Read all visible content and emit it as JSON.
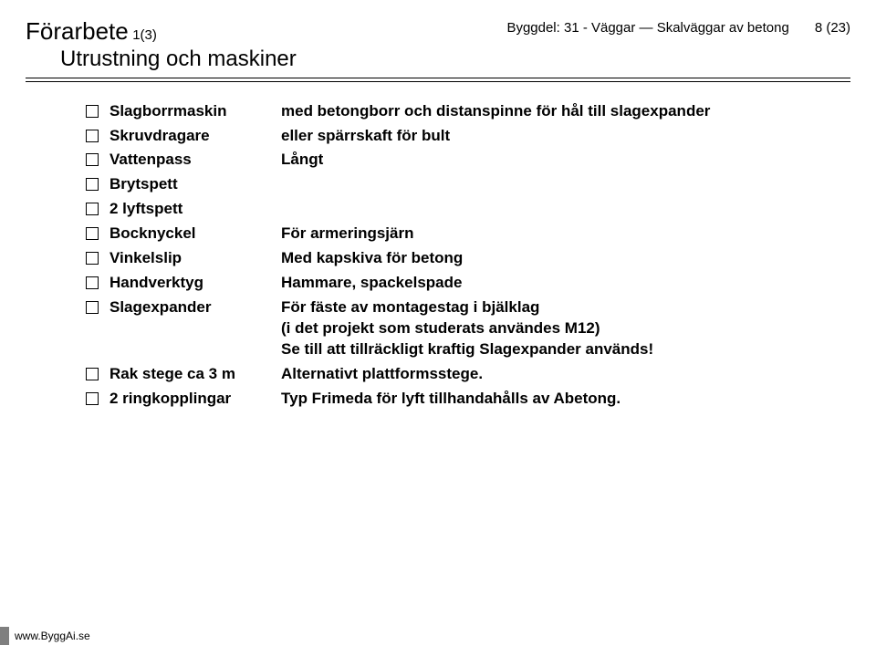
{
  "header": {
    "title": "Förarbete",
    "title_step": "1(3)",
    "subtitle": "Utrustning och maskiner",
    "right_text": "Byggdel: 31 - Väggar — Skalväggar av betong",
    "page_number": "8 (23)"
  },
  "items": [
    {
      "label": "Slagborrmaskin",
      "desc": [
        "med betongborr och distanspinne för hål till slagexpander"
      ]
    },
    {
      "label": "Skruvdragare",
      "desc": [
        "eller spärrskaft för bult"
      ]
    },
    {
      "label": "Vattenpass",
      "desc": [
        "Långt"
      ]
    },
    {
      "label": "Brytspett",
      "desc": []
    },
    {
      "label": "2 lyftspett",
      "desc": []
    },
    {
      "label": "Bocknyckel",
      "desc": [
        "För armeringsjärn"
      ]
    },
    {
      "label": "Vinkelslip",
      "desc": [
        "Med kapskiva för betong"
      ]
    },
    {
      "label": "Handverktyg",
      "desc": [
        "Hammare, spackelspade"
      ]
    },
    {
      "label": "Slagexpander",
      "desc": [
        "För fäste av montagestag i bjälklag",
        "(i det projekt som studerats användes M12)",
        "Se till att tillräckligt kraftig Slagexpander används!"
      ]
    },
    {
      "label": "Rak stege ca 3 m",
      "desc": [
        "Alternativt plattformsstege."
      ]
    },
    {
      "label": "2 ringkopplingar",
      "desc": [
        "Typ Frimeda för lyft tillhandahålls av Abetong."
      ]
    }
  ],
  "footer": {
    "url": "www.ByggAi.se"
  }
}
